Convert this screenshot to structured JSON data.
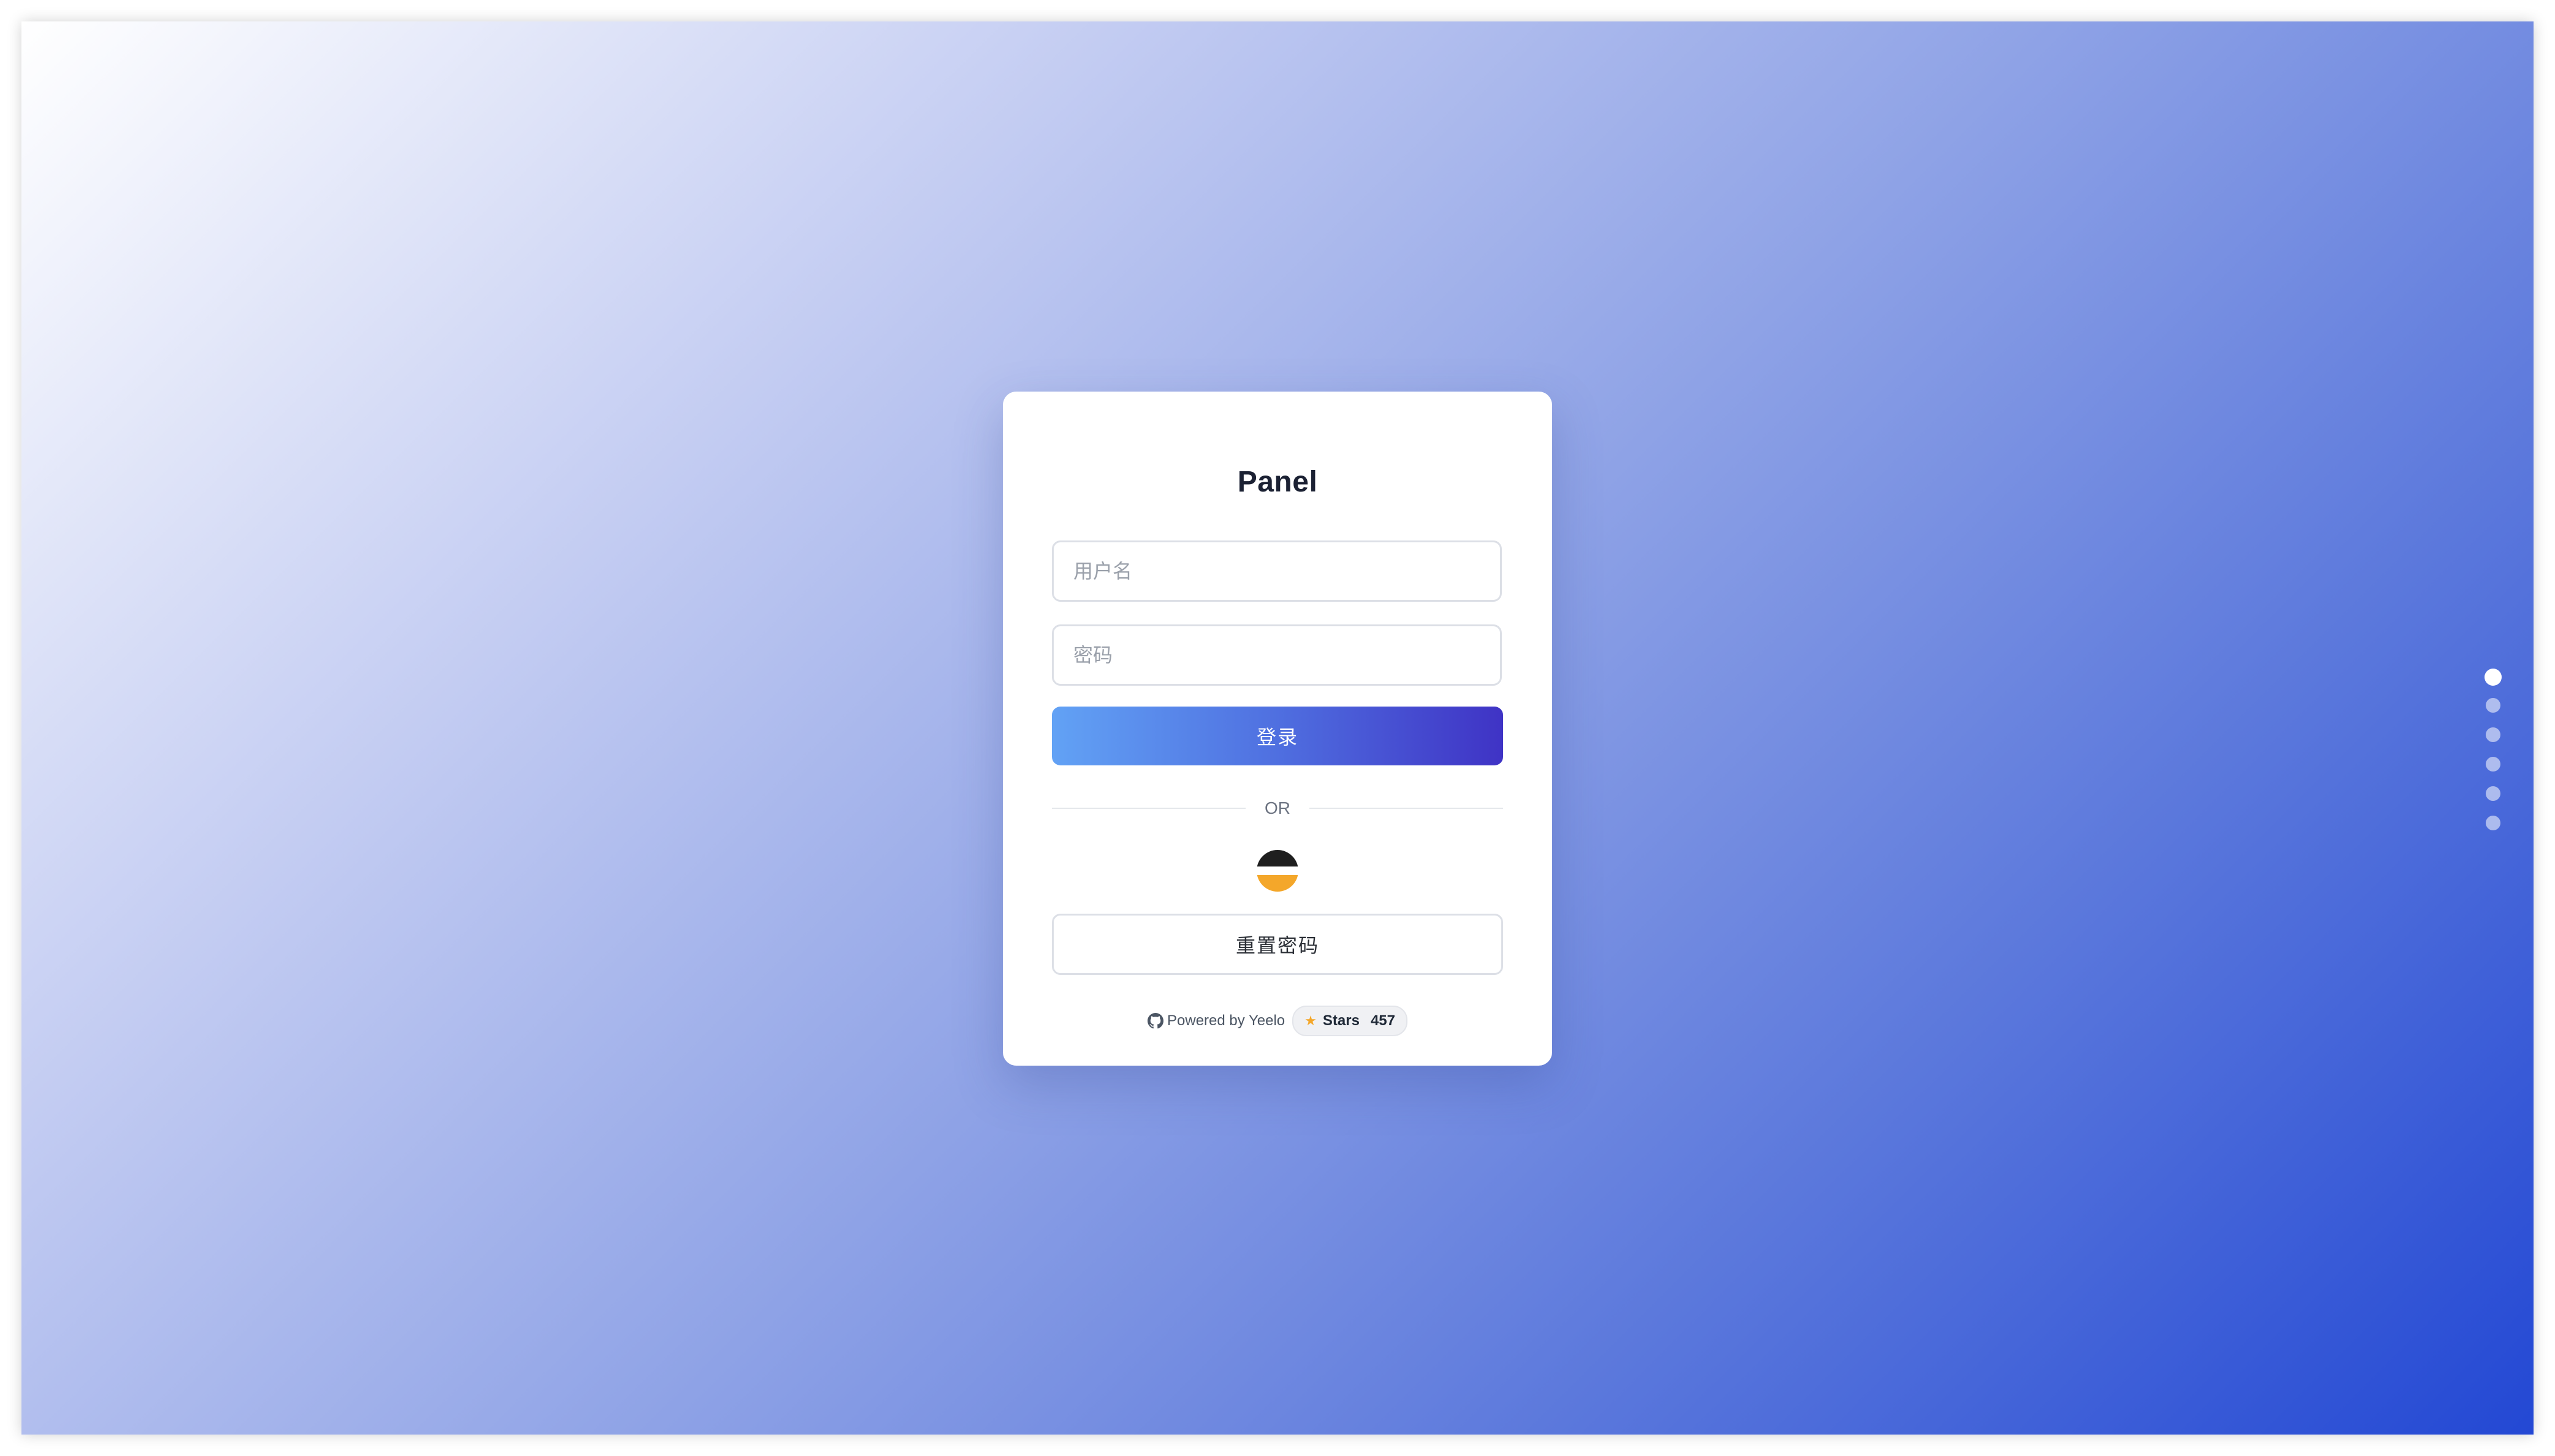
{
  "login": {
    "title": "Panel",
    "username_placeholder": "用户名",
    "password_placeholder": "密码",
    "login_label": "登录",
    "divider_label": "OR",
    "oauth_icon": "oauth-provider-icon",
    "reset_label": "重置密码"
  },
  "footer": {
    "powered_by": "Powered by Yeelo",
    "github_icon": "github-icon",
    "stars_label": "Stars",
    "stars_count": "457"
  },
  "pagination": {
    "total": 6,
    "active_index": 0
  },
  "colors": {
    "background_start": "#ffffff",
    "background_end": "#2348d4",
    "button_start": "#62a2f5",
    "button_end": "#3f33c5",
    "star": "#f4a72a"
  }
}
